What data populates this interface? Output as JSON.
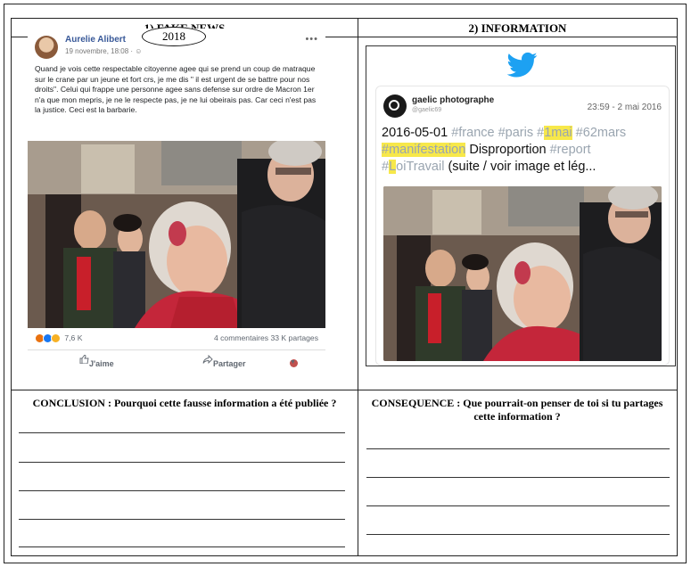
{
  "headers": {
    "left": "1) FAKE NEWS",
    "right": "2) INFORMATION"
  },
  "facebook_post": {
    "author": "Aurelie Alibert",
    "date": "19 novembre, 18:08 · ☺",
    "year_annotation": "2018",
    "text": "Quand je vois cette respectable citoyenne agee qui se prend un coup de matraque sur le crane par un jeune et fort crs, je me dis \" il est urgent de se battre pour nos droits\". Celui qui frappe une personne agee sans defense sur ordre de Macron 1er n'a que mon mepris, je ne le respecte pas, je ne lui obeirais pas. Car ceci n'est pas la justice. Ceci est la barbarie.",
    "reactions": "7,6 K",
    "stats": "4 commentaires  33 K partages",
    "like_label": "J'aime",
    "share_label": "Partager",
    "colors": {
      "name": "#385898",
      "reaction_angry": "#e9710f",
      "reaction_like": "#1877f2",
      "reaction_sad": "#f7b125"
    }
  },
  "tweet": {
    "name": "gaelic photographe",
    "handle": "@gaelic69",
    "time": "23:59 - 2 mai 2016",
    "line1": {
      "date": "2016-05-01 ",
      "t1": "#france ",
      "t2": "#paris ",
      "t3": "#",
      "t3_hl": "1mai",
      "t4": " #62mars"
    },
    "line2": {
      "t1_hl": "#manifestation",
      "plain": " Disproportion ",
      "t2": "#report"
    },
    "line3": {
      "t1a": "#",
      "t1_hl": "L",
      "t1b": "oiTravail",
      "plain": " (suite / voir image et lég..."
    },
    "colors": {
      "bird": "#1da1f2",
      "hashtag": "#9aa5b0",
      "highlight": "#f7e84a"
    }
  },
  "questions": {
    "left": "CONCLUSION : Pourquoi cette fausse information a été publiée ?",
    "right": "CONSEQUENCE : Que pourrait-on penser de toi si tu partages cette information ?"
  }
}
